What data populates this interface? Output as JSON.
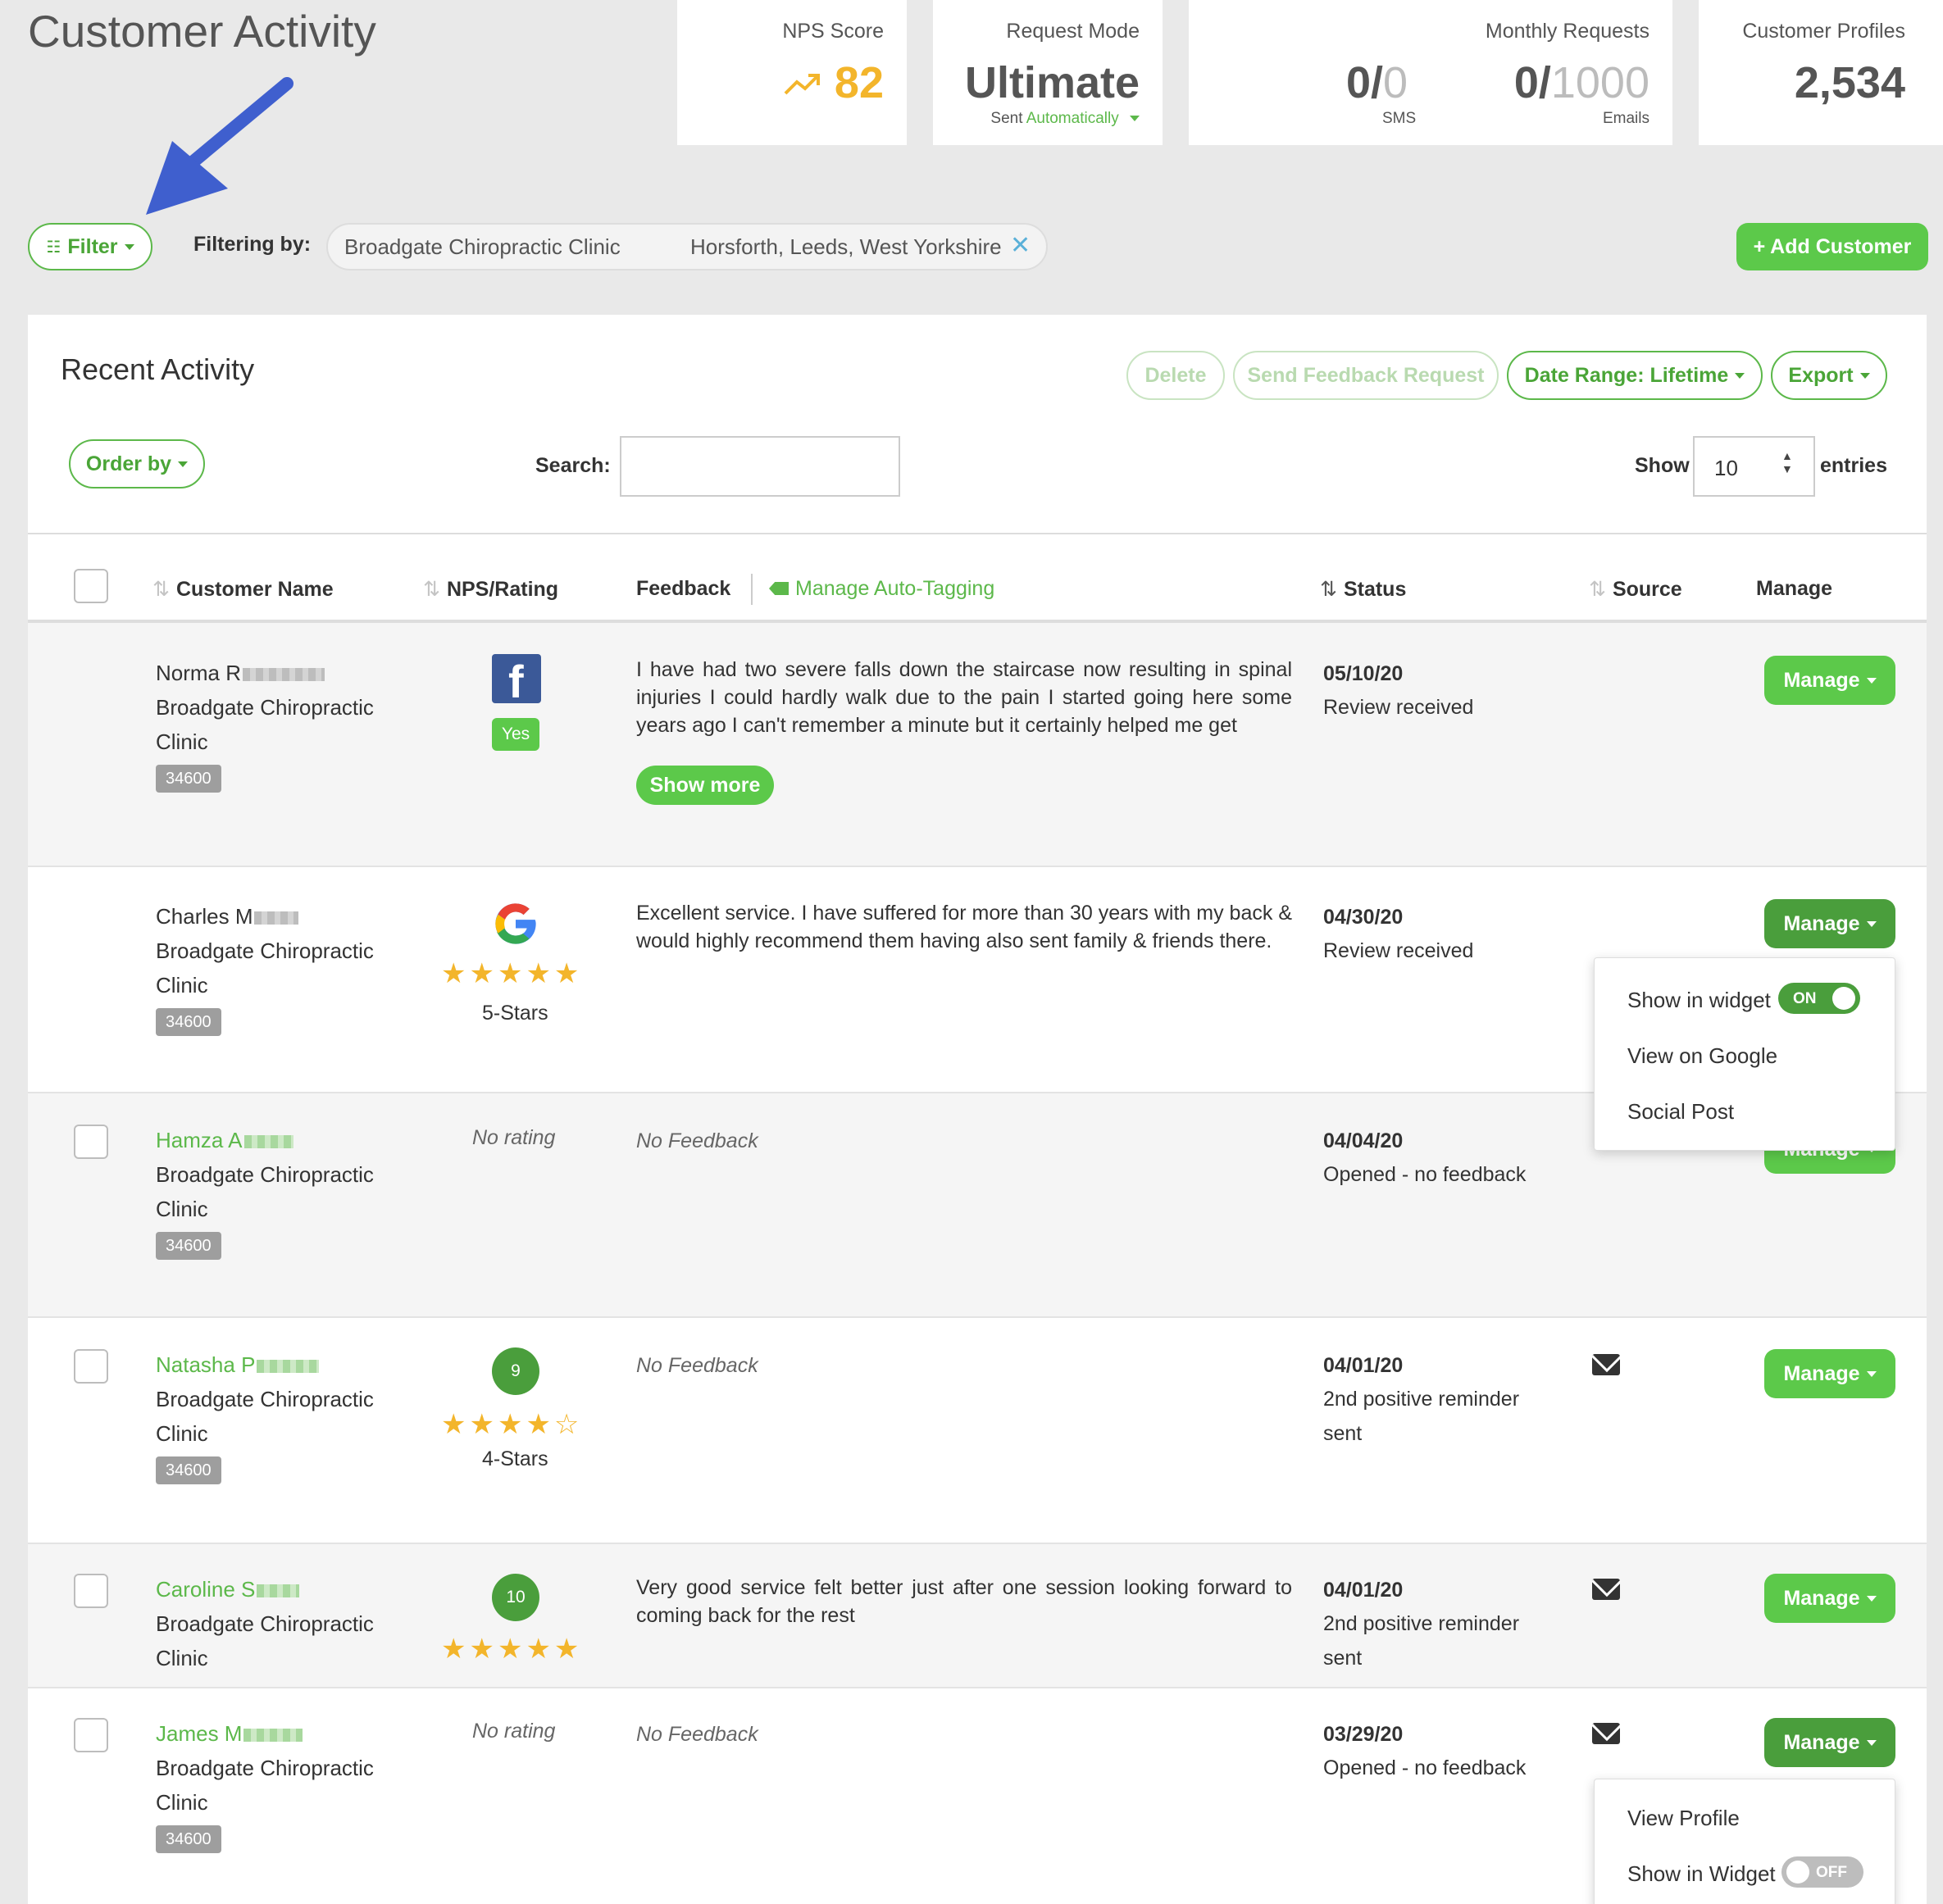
{
  "page": {
    "title": "Customer Activity"
  },
  "stats": {
    "nps": {
      "label": "NPS Score",
      "value": "82",
      "icon": "trend-up-icon"
    },
    "request_mode": {
      "label": "Request Mode",
      "value": "Ultimate",
      "sent_prefix": "Sent",
      "sent_mode": "Automatically"
    },
    "monthly": {
      "label": "Monthly Requests",
      "sms_used": "0/",
      "sms_total": "0",
      "sms_label": "SMS",
      "email_used": "0/",
      "email_total": "1000",
      "email_label": "Emails"
    },
    "profiles": {
      "label": "Customer Profiles",
      "value": "2,534"
    }
  },
  "filter_bar": {
    "filter_label": "Filter",
    "filtering_by": "Filtering by:",
    "chip_name": "Broadgate Chiropractic Clinic",
    "chip_location": "Horsforth, Leeds, West Yorkshire",
    "add_customer": "+ Add Customer"
  },
  "panel": {
    "title": "Recent Activity",
    "delete": "Delete",
    "send_feedback": "Send Feedback Request",
    "date_range": "Date Range: Lifetime",
    "export": "Export",
    "order_by": "Order by",
    "search_label": "Search:",
    "search_value": "",
    "show_label": "Show",
    "show_value": "10",
    "entries_label": "entries"
  },
  "columns": {
    "customer_name": "Customer Name",
    "nps_rating": "NPS/Rating",
    "feedback": "Feedback",
    "manage_tagging": "Manage Auto-Tagging",
    "status": "Status",
    "source": "Source",
    "manage": "Manage"
  },
  "rows": [
    {
      "name": "Norma R",
      "company_line1": "Broadgate Chiropractic",
      "company_line2": "Clinic",
      "id": "34600",
      "rating_source": "facebook-icon",
      "rating_text": "Yes",
      "feedback": "I have had two severe falls down the staircase now resulting in spinal injuries I could hardly walk due to the pain I started going here some years ago I can't remember a minute but it certainly helped me get",
      "show_more": "Show more",
      "date": "05/10/20",
      "status": "Review received",
      "manage": "Manage"
    },
    {
      "name": "Charles M",
      "company_line1": "Broadgate Chiropractic",
      "company_line2": "Clinic",
      "id": "34600",
      "rating_source": "google-icon",
      "stars": "★★★★★",
      "stars_label": "5-Stars",
      "feedback": "Excellent service. I have suffered for more than 30 years with my back & would highly recommend them having also sent family & friends there.",
      "date": "04/30/20",
      "status": "Review received",
      "manage": "Manage"
    },
    {
      "name": "Hamza A",
      "company_line1": "Broadgate Chiropractic",
      "company_line2": "Clinic",
      "id": "34600",
      "rating_text": "No rating",
      "feedback": "No Feedback",
      "date": "04/04/20",
      "status": "Opened - no feedback",
      "manage": "Manage"
    },
    {
      "name": "Natasha P",
      "company_line1": "Broadgate Chiropractic",
      "company_line2": "Clinic",
      "id": "34600",
      "nps": "9",
      "stars": "★★★★☆",
      "stars_label": "4-Stars",
      "feedback": "No Feedback",
      "date": "04/01/20",
      "status": "2nd positive reminder sent",
      "source": "email-icon",
      "manage": "Manage"
    },
    {
      "name": "Caroline S",
      "company_line1": "Broadgate Chiropractic",
      "company_line2": "Clinic",
      "nps": "10",
      "stars": "★★★★★",
      "feedback": "Very good service felt better just after one session looking forward to coming back for the rest",
      "date": "04/01/20",
      "status": "2nd positive reminder sent",
      "source": "email-icon",
      "manage": "Manage"
    },
    {
      "name": "James M",
      "company_line1": "Broadgate Chiropractic",
      "company_line2": "Clinic",
      "id": "34600",
      "rating_text": "No rating",
      "feedback": "No Feedback",
      "date": "03/29/20",
      "status": "Opened - no feedback",
      "source": "email-icon",
      "manage": "Manage"
    }
  ],
  "dropdown1": {
    "show_widget": "Show in widget",
    "toggle": "ON",
    "view_google": "View on Google",
    "social_post": "Social Post"
  },
  "dropdown2": {
    "view_profile": "View Profile",
    "show_widget": "Show in Widget",
    "toggle": "OFF"
  },
  "colors": {
    "accent": "#5cb84a",
    "button": "#5cc94a",
    "button_dark": "#4a9e3c",
    "nps": "#f3b52b",
    "arrow": "#3f5fce"
  }
}
